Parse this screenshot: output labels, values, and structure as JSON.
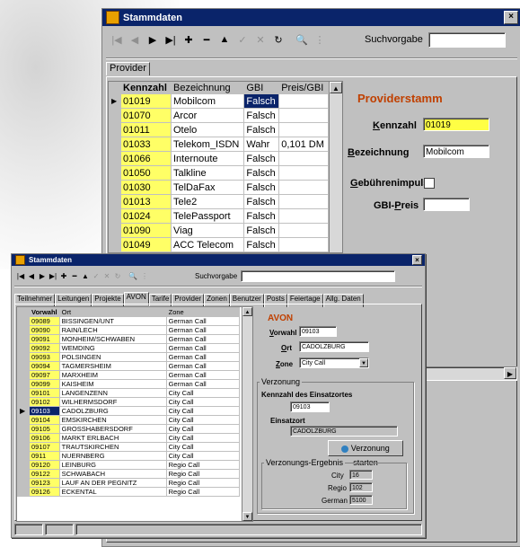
{
  "big": {
    "title": "Stammdaten",
    "close": "×",
    "toolbar": [
      "|◀",
      "◀",
      "▶",
      "▶|",
      "✚",
      "━",
      "▲",
      "✓",
      "✕",
      "↻",
      "🔍",
      "⋮"
    ],
    "suchvorgabe_label": "Suchvorgabe",
    "suchvorgabe_value": "",
    "tab": "Provider",
    "columns": [
      "Kennzahl",
      "Bezeichnung",
      "GBI",
      "Preis/GBI"
    ],
    "rows": [
      [
        "01019",
        "Mobilcom",
        "Falsch",
        ""
      ],
      [
        "01070",
        "Arcor",
        "Falsch",
        ""
      ],
      [
        "01011",
        "Otelo",
        "Falsch",
        ""
      ],
      [
        "01033",
        "Telekom_ISDN",
        "Wahr",
        "0,101 DM"
      ],
      [
        "01066",
        "Internoute",
        "Falsch",
        ""
      ],
      [
        "01050",
        "Talkline",
        "Falsch",
        ""
      ],
      [
        "01030",
        "TelDaFax",
        "Falsch",
        ""
      ],
      [
        "01013",
        "Tele2",
        "Falsch",
        ""
      ],
      [
        "01024",
        "TelePassport",
        "Falsch",
        ""
      ],
      [
        "01090",
        "Viag",
        "Falsch",
        ""
      ],
      [
        "01049",
        "ACC Telecom",
        "Falsch",
        ""
      ]
    ],
    "form_title": "Providerstamm",
    "kennzahl_label": "Kennzahl",
    "kennzahl_value": "01019",
    "bezeichnung_label": "Bezeichnung",
    "bezeichnung_value": "Mobilcom",
    "gebuehren_label": "Gebührenimpuls",
    "gbi_preis_label": "GBI-Preis",
    "gbi_preis_value": ""
  },
  "small": {
    "title": "Stammdaten",
    "close": "×",
    "toolbar": [
      "|◀",
      "◀",
      "▶",
      "▶|",
      "✚",
      "━",
      "▲",
      "✓",
      "✕",
      "↻",
      "🔍",
      "⋮"
    ],
    "suchvorgabe_label": "Suchvorgabe",
    "suchvorgabe_value": "",
    "tabs": [
      "Teilnehmer",
      "Leitungen",
      "Projekte",
      "AVON",
      "Tarife",
      "Provider",
      "Zonen",
      "Benutzer",
      "Posts",
      "Feiertage",
      "Allg. Daten"
    ],
    "active_tab": 3,
    "columns": [
      "Vorwahl",
      "Ort",
      "Zone"
    ],
    "rows": [
      [
        "09089",
        "BISSINGEN/UNT",
        "German Call"
      ],
      [
        "09090",
        "RAIN/LECH",
        "German Call"
      ],
      [
        "09091",
        "MONHEIM/SCHWABEN",
        "German Call"
      ],
      [
        "09092",
        "WEMDING",
        "German Call"
      ],
      [
        "09093",
        "POLSINGEN",
        "German Call"
      ],
      [
        "09094",
        "TAGMERSHEIM",
        "German Call"
      ],
      [
        "09097",
        "MARXHEIM",
        "German Call"
      ],
      [
        "09099",
        "KAISHEIM",
        "German Call"
      ],
      [
        "09101",
        "LANGENZENN",
        "City Call"
      ],
      [
        "09102",
        "WILHERMSDORF",
        "City Call"
      ],
      [
        "09103",
        "CADOLZBURG",
        "City Call"
      ],
      [
        "09104",
        "EMSKIRCHEN",
        "City Call"
      ],
      [
        "09105",
        "GROSSHABERSDORF",
        "City Call"
      ],
      [
        "09106",
        "MARKT ERLBACH",
        "City Call"
      ],
      [
        "09107",
        "TRAUTSKIRCHEN",
        "City Call"
      ],
      [
        "0911",
        "NUERNBERG",
        "City Call"
      ],
      [
        "09120",
        "LEINBURG",
        "Regio Call"
      ],
      [
        "09122",
        "SCHWABACH",
        "Regio Call"
      ],
      [
        "09123",
        "LAUF AN DER PEGNITZ",
        "Regio Call"
      ],
      [
        "09126",
        "ECKENTAL",
        "Regio Call"
      ]
    ],
    "selected_row": 10,
    "form_title": "AVON",
    "vorwahl_label": "Vorwahl",
    "vorwahl_value": "09103",
    "ort_label": "Ort",
    "ort_value": "CADOLZBURG",
    "zone_label": "Zone",
    "zone_value": "City Call",
    "verzonung_group": "Verzonung",
    "kennzahl_einsatzort_label": "Kennzahl des Einsatzortes",
    "kennzahl_einsatzort_value": "09103",
    "einsatzort_label": "Einsatzort",
    "einsatzort_value": "CADOLZBURG",
    "verzonung_button": "Verzonung starten",
    "ergebnis_group": "Verzonungs-Ergebnis",
    "city_label": "City",
    "city_value": "16",
    "regio_label": "Regio",
    "regio_value": "102",
    "german_label": "German",
    "german_value": "5100"
  }
}
